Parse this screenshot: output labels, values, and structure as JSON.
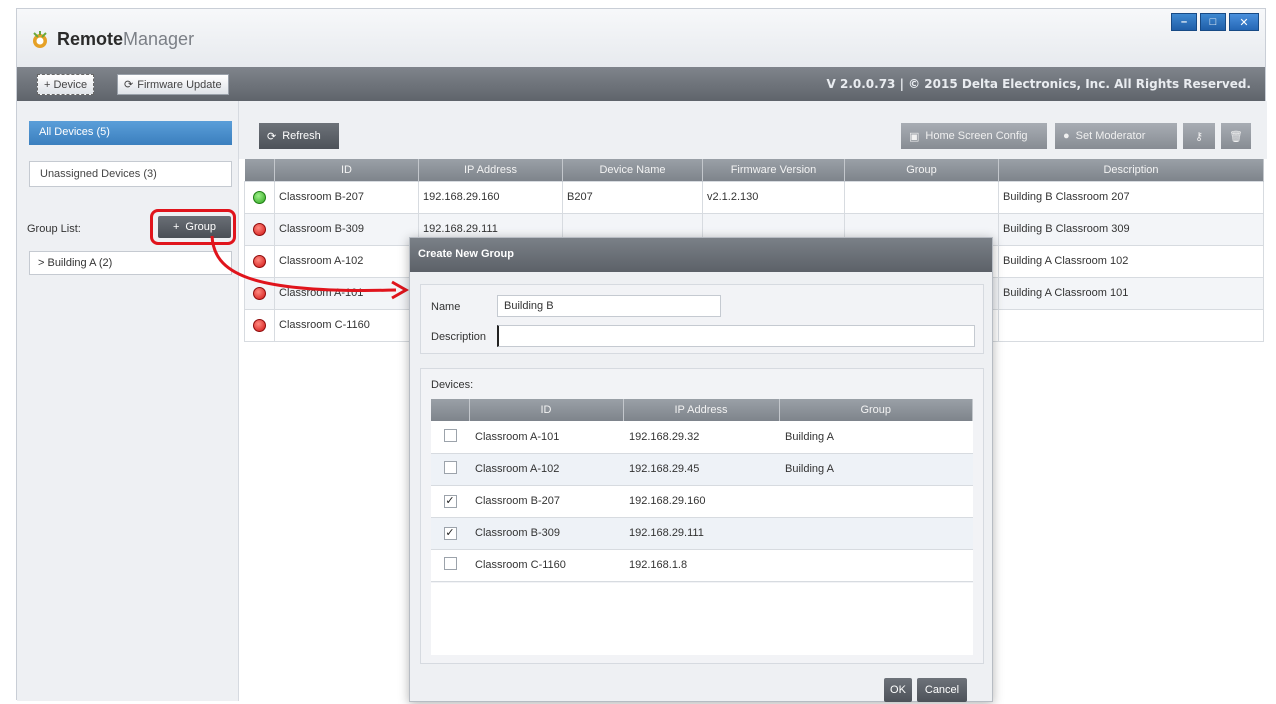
{
  "app": {
    "title_bold": "Remote",
    "title_light": "Manager",
    "copyright": "V 2.0.0.73 | © 2015 Delta Electronics, Inc. All Rights Reserved."
  },
  "window_controls": {
    "minimize": "–",
    "maximize": "□",
    "close": "✕"
  },
  "toolbar": {
    "device_label": "+ Device",
    "firmware_label": "Firmware Update"
  },
  "sidebar": {
    "all_devices": "All Devices (5)",
    "unassigned": "Unassigned Devices (3)",
    "group_list_label": "Group List:",
    "group_button": "Group",
    "groups": [
      {
        "label": "> Building A (2)"
      }
    ]
  },
  "main": {
    "refresh": "Refresh",
    "home_screen_config": "Home Screen Config",
    "set_moderator": "Set Moderator",
    "columns": [
      "",
      "ID",
      "IP Address",
      "Device Name",
      "Firmware Version",
      "Group",
      "Description"
    ],
    "rows": [
      {
        "status": "green",
        "id": "Classroom B-207",
        "ip": "192.168.29.160",
        "name": "B207",
        "fw": "v2.1.2.130",
        "group": "",
        "desc": "Building B Classroom 207"
      },
      {
        "status": "red",
        "id": "Classroom B-309",
        "ip": "192.168.29.111",
        "name": "",
        "fw": "",
        "group": "",
        "desc": "Building B Classroom 309"
      },
      {
        "status": "red",
        "id": "Classroom A-102",
        "ip": "",
        "name": "",
        "fw": "",
        "group": "",
        "desc": "Building A Classroom 102"
      },
      {
        "status": "red",
        "id": "Classroom A-101",
        "ip": "",
        "name": "",
        "fw": "",
        "group": "",
        "desc": "Building A Classroom 101"
      },
      {
        "status": "red",
        "id": "Classroom C-1160",
        "ip": "",
        "name": "",
        "fw": "",
        "group": "",
        "desc": ""
      }
    ]
  },
  "dialog": {
    "title": "Create New Group",
    "name_label": "Name",
    "name_value": "Building B",
    "description_label": "Description",
    "description_value": "",
    "devices_label": "Devices:",
    "columns": [
      "",
      "ID",
      "IP Address",
      "Group"
    ],
    "rows": [
      {
        "checked": false,
        "id": "Classroom A-101",
        "ip": "192.168.29.32",
        "group": "Building A"
      },
      {
        "checked": false,
        "id": "Classroom A-102",
        "ip": "192.168.29.45",
        "group": "Building A"
      },
      {
        "checked": true,
        "id": "Classroom B-207",
        "ip": "192.168.29.160",
        "group": ""
      },
      {
        "checked": true,
        "id": "Classroom B-309",
        "ip": "192.168.29.111",
        "group": ""
      },
      {
        "checked": false,
        "id": "Classroom C-1160",
        "ip": "192.168.1.8",
        "group": ""
      }
    ],
    "ok": "OK",
    "cancel": "Cancel"
  },
  "colors": {
    "accent": "#3b7fbe",
    "highlight": "#e0141c",
    "status_ok": "#2ea51e",
    "status_off": "#d21414"
  }
}
